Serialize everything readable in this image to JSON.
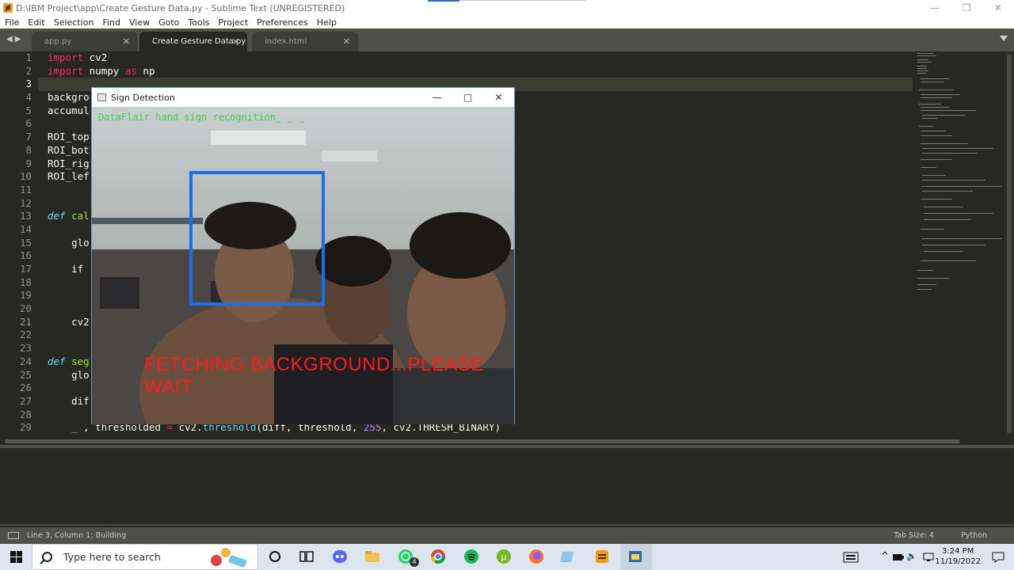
{
  "window": {
    "title": "D:\\IBM Project\\app\\Create Gesture Data.py - Sublime Text (UNREGISTERED)",
    "controls": [
      "minimize-icon",
      "maximize-icon",
      "close-icon"
    ]
  },
  "menu": [
    "File",
    "Edit",
    "Selection",
    "Find",
    "View",
    "Goto",
    "Tools",
    "Project",
    "Preferences",
    "Help"
  ],
  "tabs": [
    {
      "label": "app.py",
      "active": false
    },
    {
      "label": "Create Gesture Data.py",
      "active": true
    },
    {
      "label": "index.html",
      "active": false
    }
  ],
  "editor": {
    "line_numbers": [
      "1",
      "2",
      "3",
      "4",
      "5",
      "6",
      "7",
      "8",
      "9",
      "10",
      "11",
      "12",
      "13",
      "14",
      "15",
      "16",
      "17",
      "18",
      "19",
      "20",
      "21",
      "22",
      "23",
      "24",
      "25",
      "26",
      "27",
      "28",
      "29"
    ],
    "current_line": 3,
    "visible_code": {
      "l1_kw": "import",
      "l1_rest": " cv2",
      "l2_kw": "import",
      "l2_mid": " numpy ",
      "l2_kw2": "as",
      "l2_rest": " np",
      "l4": "backgro",
      "l5": "accumul",
      "l7": "ROI_top",
      "l8": "ROI_bot",
      "l9": "ROI_rig",
      "l10": "ROI_lef",
      "l13_def": "def",
      "l13_rest": " cal",
      "l15": "    glo",
      "l17_kw": "    if",
      "l21": "    cv2",
      "l24_def": "def",
      "l24_rest": " seg",
      "l25": "    glo",
      "l27": "    dif",
      "l29_a": "    _ ",
      "l29_b": ", thresholded ",
      "l29_eq": "=",
      "l29_c": " cv2.",
      "l29_fn": "threshold",
      "l29_d": "(diff, threshold, ",
      "l29_num": "255",
      "l29_e": ", cv2.THRESH_BINARY)"
    }
  },
  "dialog": {
    "title": "Sign Detection",
    "overlay_top": "DataFlair hand sign recognition_ _ _",
    "overlay_main": "FETCHING BACKGROUND...PLEASE WAIT",
    "overlay_top_color": "#2ecc40",
    "overlay_main_color": "#ff1a1a",
    "box_color": "#1e6fe6"
  },
  "status": {
    "left": "Line 3, Column 1; Building",
    "tab_size": "Tab Size: 4",
    "syntax": "Python"
  },
  "taskbar": {
    "search_placeholder": "Type here to search",
    "whatsapp_badge": "4",
    "time": "3:24 PM",
    "date": "11/19/2022",
    "icons": [
      "windows-start-icon",
      "cortana-icon",
      "task-view-icon",
      "discord-icon",
      "file-explorer-icon",
      "whatsapp-icon",
      "chrome-icon",
      "spotify-icon",
      "utorrent-icon",
      "firefox-icon",
      "notepad-icon",
      "sublime-icon",
      "python-icon"
    ]
  }
}
